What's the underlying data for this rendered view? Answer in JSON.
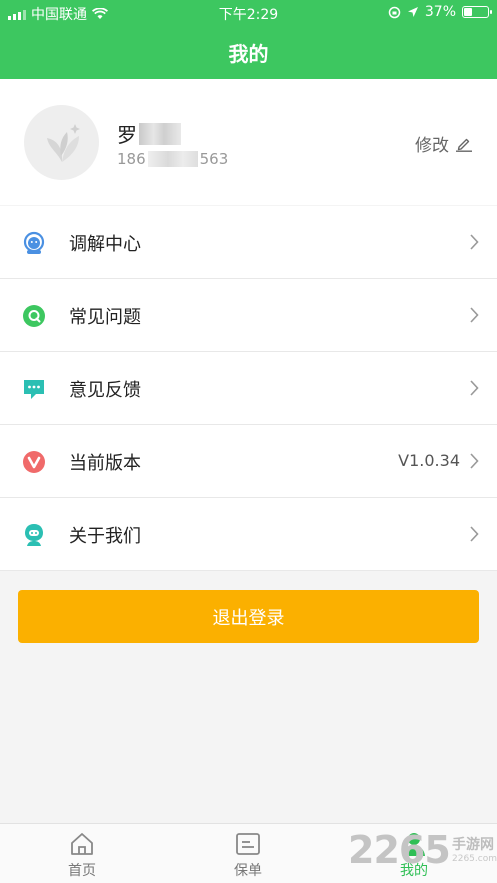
{
  "status_bar": {
    "carrier": "中国联通",
    "time": "下午2:29",
    "battery_percent": "37%",
    "battery_level": 0.37
  },
  "header": {
    "title": "我的"
  },
  "profile": {
    "name_visible": "罗",
    "phone_prefix": "186",
    "phone_suffix": "563",
    "edit_label": "修改"
  },
  "menu": {
    "items": [
      {
        "label": "调解中心",
        "icon": "headset-icon",
        "color": "#4a90e2"
      },
      {
        "label": "常见问题",
        "icon": "question-icon",
        "color": "#3dc760"
      },
      {
        "label": "意见反馈",
        "icon": "feedback-icon",
        "color": "#2bbfb3"
      },
      {
        "label": "当前版本",
        "icon": "version-icon",
        "color": "#f06a6a",
        "value": "V1.0.34"
      },
      {
        "label": "关于我们",
        "icon": "about-icon",
        "color": "#2bbfb3"
      }
    ]
  },
  "logout_label": "退出登录",
  "tabs": [
    {
      "label": "首页",
      "icon": "home-icon"
    },
    {
      "label": "保单",
      "icon": "policy-icon"
    },
    {
      "label": "我的",
      "icon": "profile-icon",
      "active": true
    }
  ],
  "watermark": {
    "number": "2265",
    "text": "手游网",
    "url": "2265.com"
  },
  "colors": {
    "primary": "#3dc760",
    "logout": "#fbb000"
  }
}
